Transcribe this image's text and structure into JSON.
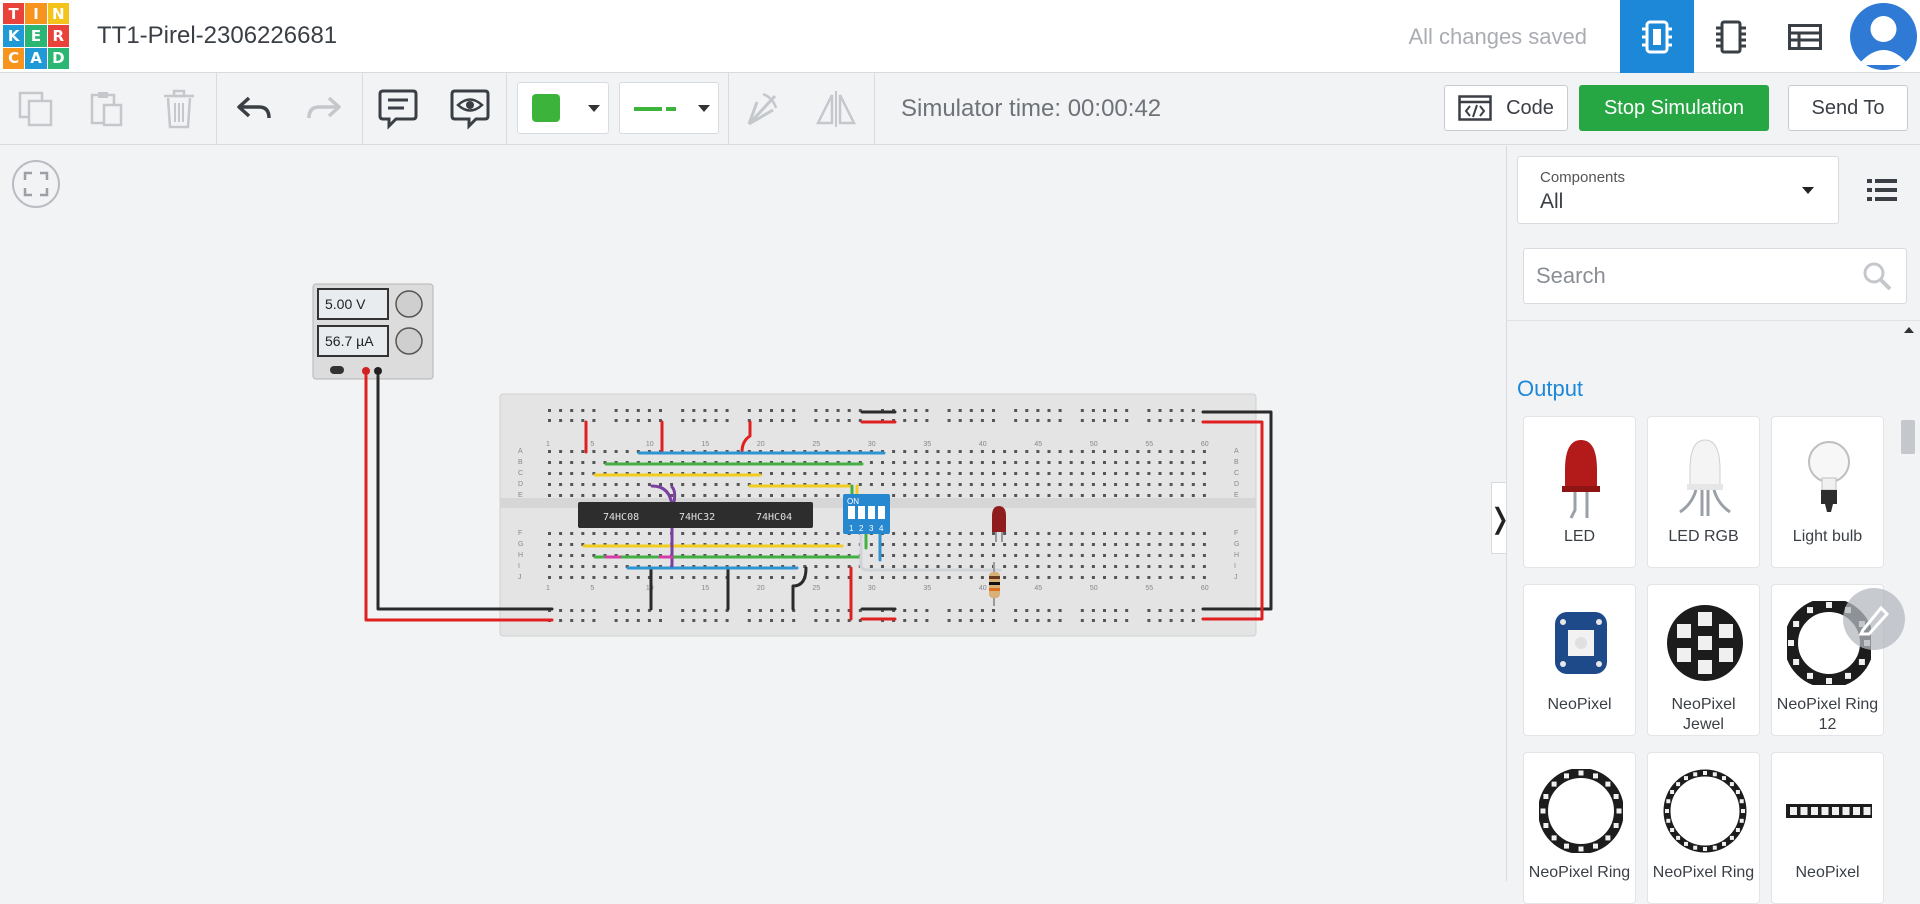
{
  "header": {
    "logo_letters": [
      "T",
      "I",
      "N",
      "K",
      "E",
      "R",
      "C",
      "A",
      "D"
    ],
    "logo_colors": [
      "#e8423a",
      "#f7941d",
      "#f4c31c",
      "#1f9ad6",
      "#2bb673",
      "#e8423a",
      "#f7941d",
      "#1f9ad6",
      "#2bb673"
    ],
    "title": "TT1-Pirel-2306226681",
    "save_status": "All changes saved",
    "views": [
      "circuit-view-icon",
      "schematic-view-icon",
      "component-list-icon"
    ]
  },
  "toolbar": {
    "copy": "copy-icon",
    "paste": "paste-icon",
    "delete": "trash-icon",
    "undo": "undo-icon",
    "redo": "redo-icon",
    "notes": "notes-icon",
    "notes_visibility": "notes-visibility-icon",
    "color": "#3cb43c",
    "rotate": "rotate-icon",
    "flip": "flip-icon",
    "sim_time": "Simulator time: 00:00:42",
    "code_label": "Code",
    "stop_label": "Stop Simulation",
    "send_label": "Send To"
  },
  "canvas": {
    "psu_voltage": "5.00 V",
    "psu_current": "56.7 µA",
    "ic1": "74HC08",
    "ic2": "74HC32",
    "ic3": "74HC04",
    "dip_on": "ON",
    "dip_nums": [
      "1",
      "2",
      "3",
      "4"
    ],
    "col_numbers": [
      "1",
      "5",
      "10",
      "15",
      "20",
      "25",
      "30",
      "35",
      "40",
      "45",
      "50",
      "55",
      "60"
    ],
    "row_letters_top": [
      "A",
      "B",
      "C",
      "D",
      "E"
    ],
    "row_letters_bottom": [
      "F",
      "G",
      "H",
      "I",
      "J"
    ]
  },
  "panel": {
    "select_label": "Components",
    "select_value": "All",
    "search_placeholder": "Search",
    "section": "Output",
    "components": [
      {
        "name": "LED"
      },
      {
        "name": "LED RGB"
      },
      {
        "name": "Light bulb"
      },
      {
        "name": "NeoPixel"
      },
      {
        "name": "NeoPixel Jewel"
      },
      {
        "name": "NeoPixel Ring 12"
      },
      {
        "name": "NeoPixel Ring"
      },
      {
        "name": "NeoPixel Ring"
      },
      {
        "name": "NeoPixel"
      }
    ]
  },
  "colors": {
    "accent": "#1d87d8",
    "stop": "#27a744",
    "wire_red": "#e02020",
    "wire_black": "#2a2a2a",
    "wire_blue": "#2e95d3",
    "wire_green": "#44b044",
    "wire_yellow": "#f2cc1f",
    "wire_purple": "#7b3fa0",
    "wire_magenta": "#d63ca8"
  }
}
